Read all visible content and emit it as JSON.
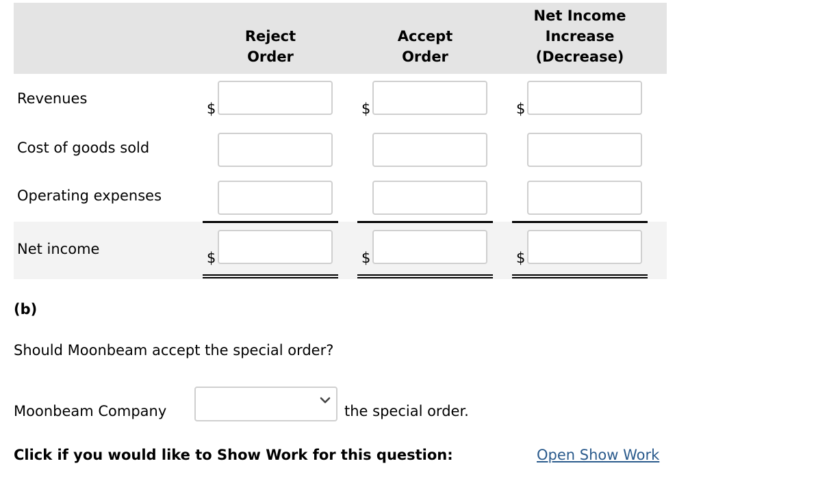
{
  "table": {
    "columns": [
      {
        "line1": "",
        "line2": "Reject",
        "line3": "Order"
      },
      {
        "line1": "",
        "line2": "Accept",
        "line3": "Order"
      },
      {
        "line1": "Net Income",
        "line2": "Increase",
        "line3": "(Decrease)"
      }
    ],
    "rows": [
      {
        "label": "Revenues",
        "currency_symbol": "$",
        "values": [
          "",
          "",
          ""
        ]
      },
      {
        "label": "Cost of goods sold",
        "currency_symbol": "",
        "values": [
          "",
          "",
          ""
        ]
      },
      {
        "label": "Operating expenses",
        "currency_symbol": "",
        "values": [
          "",
          "",
          ""
        ]
      },
      {
        "label": "Net income",
        "currency_symbol": "$",
        "values": [
          "",
          "",
          ""
        ]
      }
    ],
    "currency": "$"
  },
  "part_b": {
    "section_label": "(b)",
    "question": "Should Moonbeam accept the special order?",
    "company_label": "Moonbeam Company",
    "select_value": "",
    "after_select": "the special order."
  },
  "show_work": {
    "prompt": "Click if you would like to Show Work for this question:",
    "link_label": "Open Show Work",
    "link_color": "#2a5a8c"
  }
}
